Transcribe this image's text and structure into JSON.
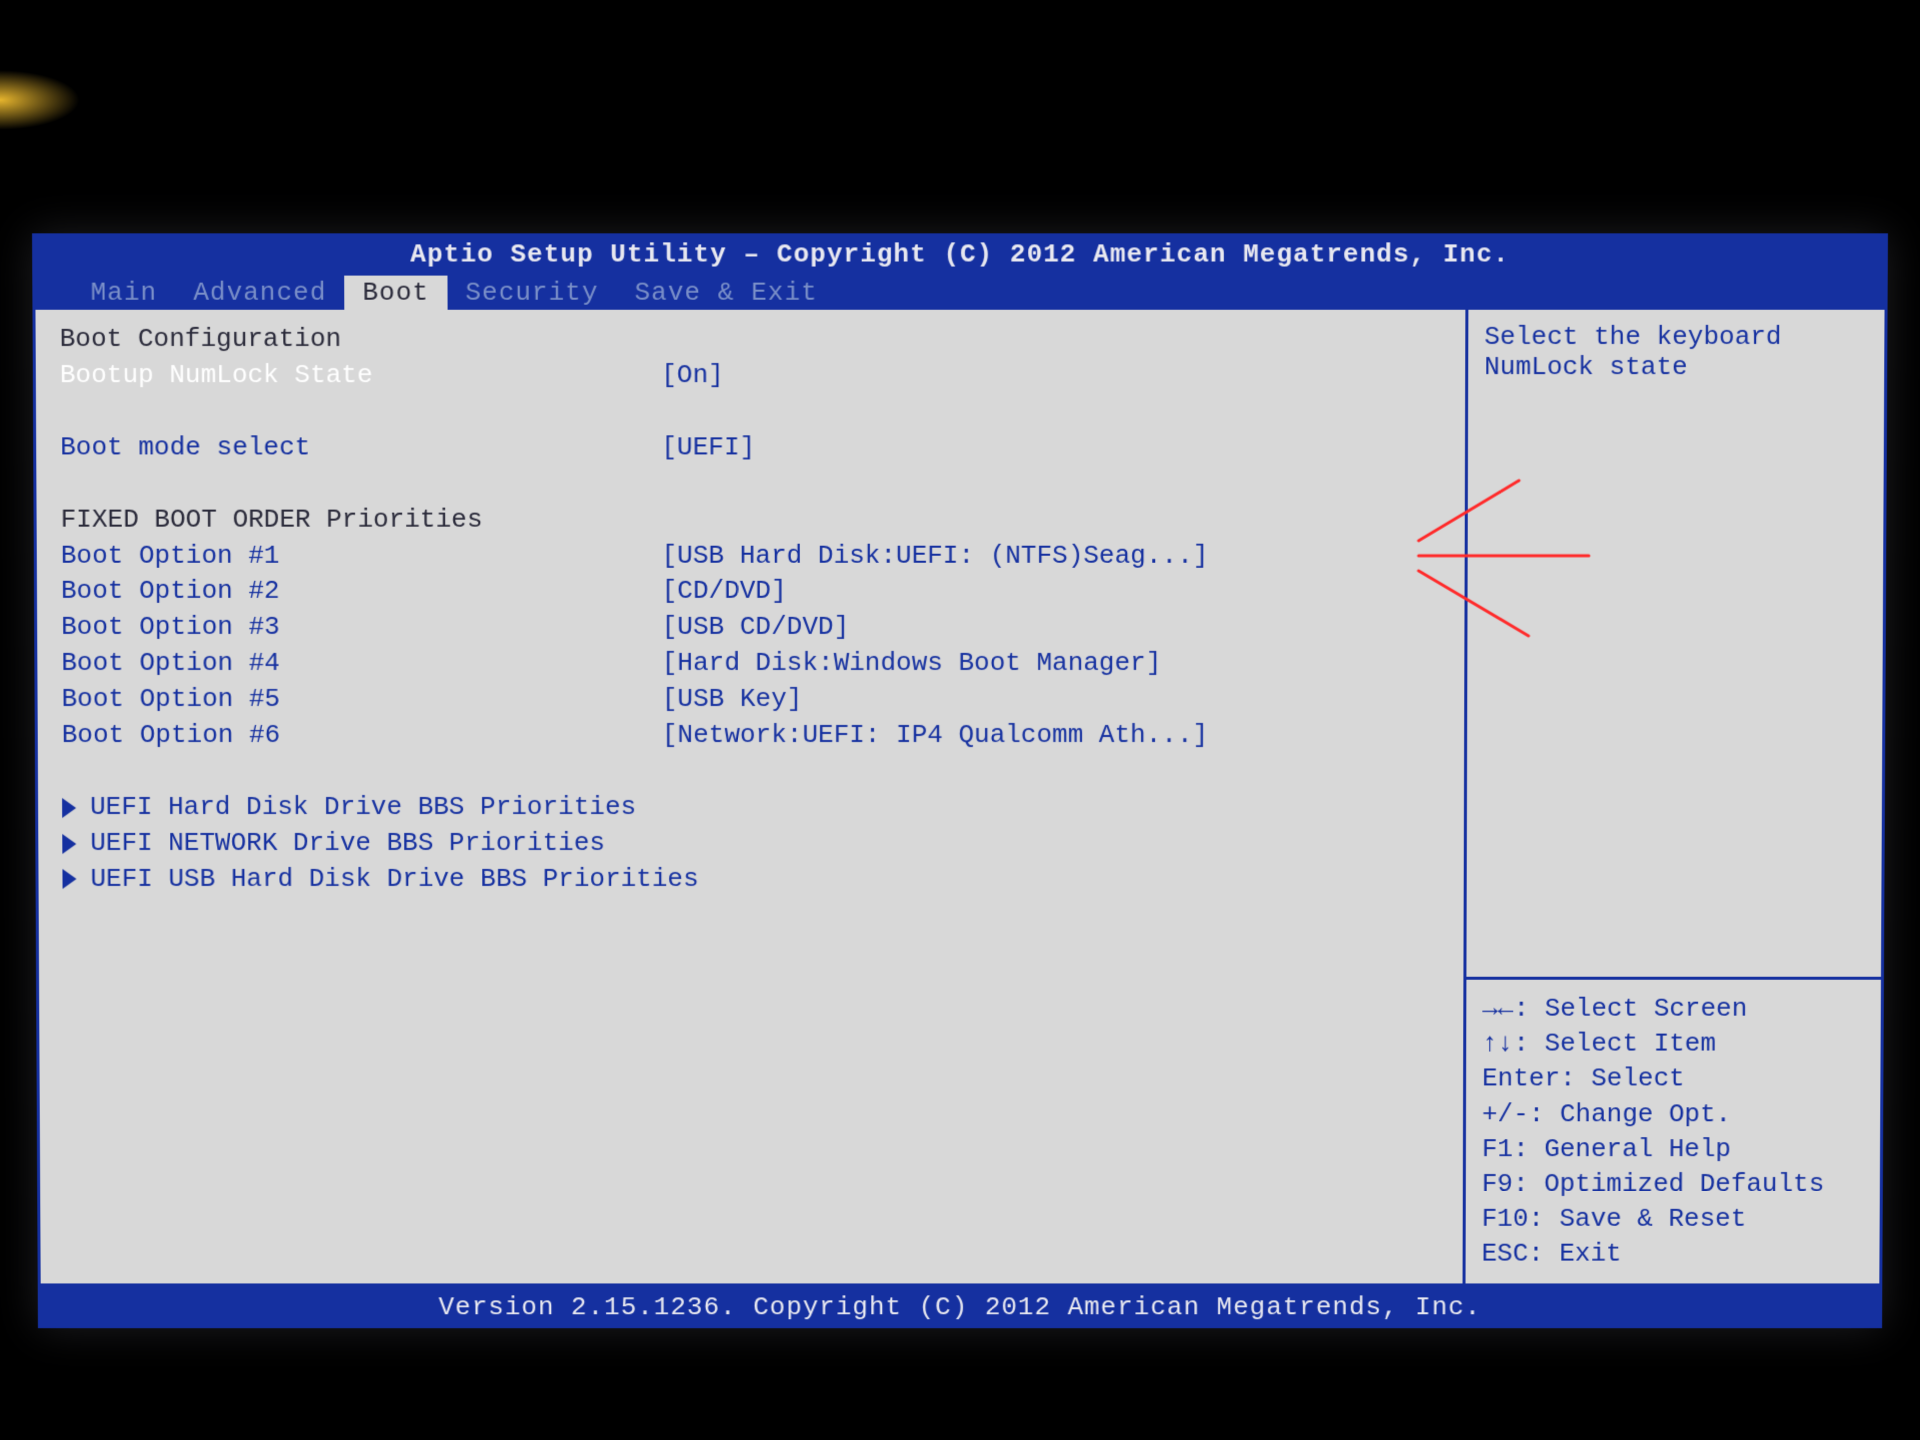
{
  "title": "Aptio Setup Utility – Copyright (C) 2012 American Megatrends, Inc.",
  "tabs": {
    "items": [
      "Main",
      "Advanced",
      "Boot",
      "Security",
      "Save & Exit"
    ],
    "active_index": 2
  },
  "main": {
    "section1": "Boot Configuration",
    "numlock": {
      "label": "Bootup NumLock State",
      "value": "[On]"
    },
    "bootmode": {
      "label": "Boot mode select",
      "value": "[UEFI]"
    },
    "section2": "FIXED BOOT ORDER Priorities",
    "boot_options": [
      {
        "label": "Boot Option #1",
        "value": "[USB Hard Disk:UEFI: (NTFS)Seag...]"
      },
      {
        "label": "Boot Option #2",
        "value": "[CD/DVD]"
      },
      {
        "label": "Boot Option #3",
        "value": "[USB CD/DVD]"
      },
      {
        "label": "Boot Option #4",
        "value": "[Hard Disk:Windows Boot Manager]"
      },
      {
        "label": "Boot Option #5",
        "value": "[USB Key]"
      },
      {
        "label": "Boot Option #6",
        "value": "[Network:UEFI: IP4 Qualcomm Ath...]"
      }
    ],
    "submenus": [
      "UEFI Hard Disk Drive BBS Priorities",
      "UEFI NETWORK Drive BBS Priorities",
      "UEFI USB Hard Disk Drive BBS Priorities"
    ]
  },
  "help": {
    "line1": "Select the keyboard",
    "line2": "NumLock state"
  },
  "keys": {
    "k0": "→←: Select Screen",
    "k1": "↑↓: Select Item",
    "k2": "Enter: Select",
    "k3": "+/-: Change Opt.",
    "k4": "F1: General Help",
    "k5": "F9: Optimized Defaults",
    "k6": "F10: Save & Reset",
    "k7": "ESC: Exit"
  },
  "footer": "Version 2.15.1236. Copyright (C) 2012 American Megatrends, Inc."
}
